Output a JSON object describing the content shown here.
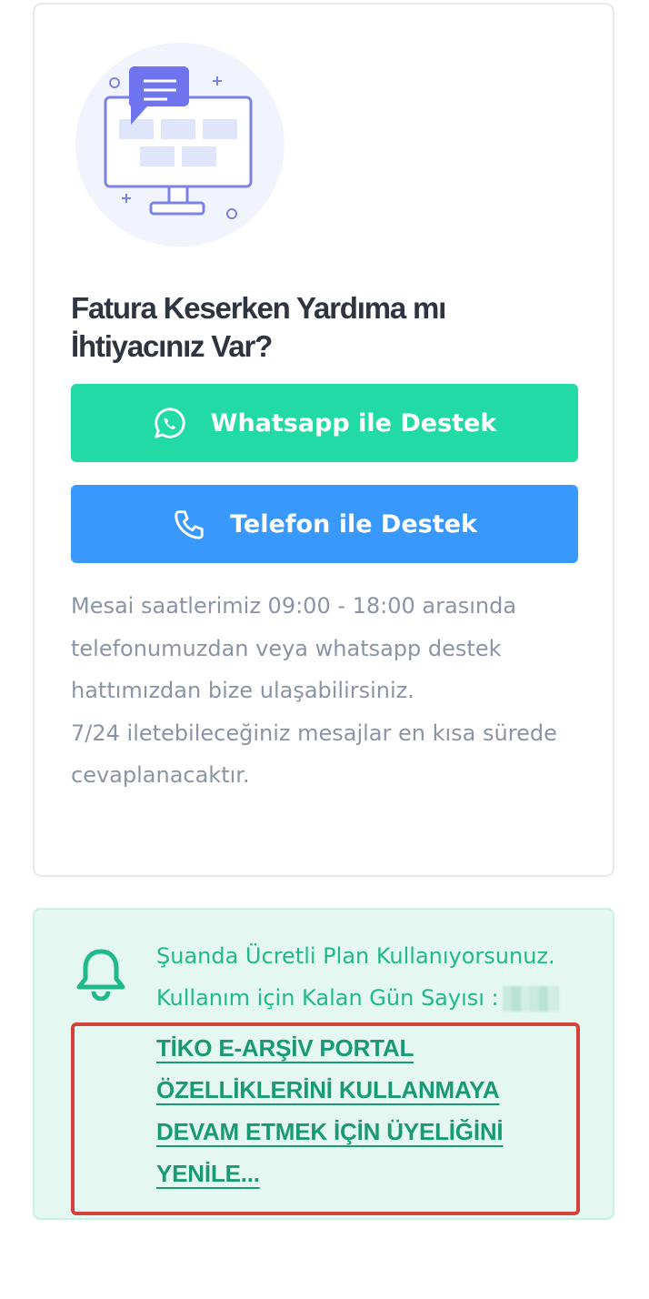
{
  "help": {
    "title": "Fatura Keserken Yardıma mı İhtiyacınız Var?",
    "whatsapp_label": "Whatsapp ile Destek",
    "phone_label": "Telefon ile Destek",
    "info_line1": "Mesai saatlerimiz 09:00 - 18:00 arasında telefonumuzdan veya whatsapp destek hattımızdan bize ulaşabilirsiniz.",
    "info_line2": "7/24 iletebileceğiniz mesajlar en kısa sürede cevaplanacaktır.",
    "illustration_icon": "monitor-chat-illustration",
    "whatsapp_icon": "whatsapp-icon",
    "phone_icon": "phone-icon"
  },
  "plan": {
    "status": "Şuanda Ücretli Plan Kullanıyorsunuz.",
    "days_label": "Kullanım için Kalan Gün Sayısı :",
    "renew_link": "TİKO E-ARŞİV PORTAL ÖZELLİKLERİNİ KULLANMAYA DEVAM ETMEK İÇİN ÜYELİĞİNİ YENİLE...",
    "bell_icon": "bell-icon"
  },
  "colors": {
    "whatsapp": "#22dba4",
    "phone": "#3898fb",
    "plan_bg": "#e4f8f1",
    "plan_text": "#1fb98c",
    "highlight_border": "#d2423a"
  }
}
